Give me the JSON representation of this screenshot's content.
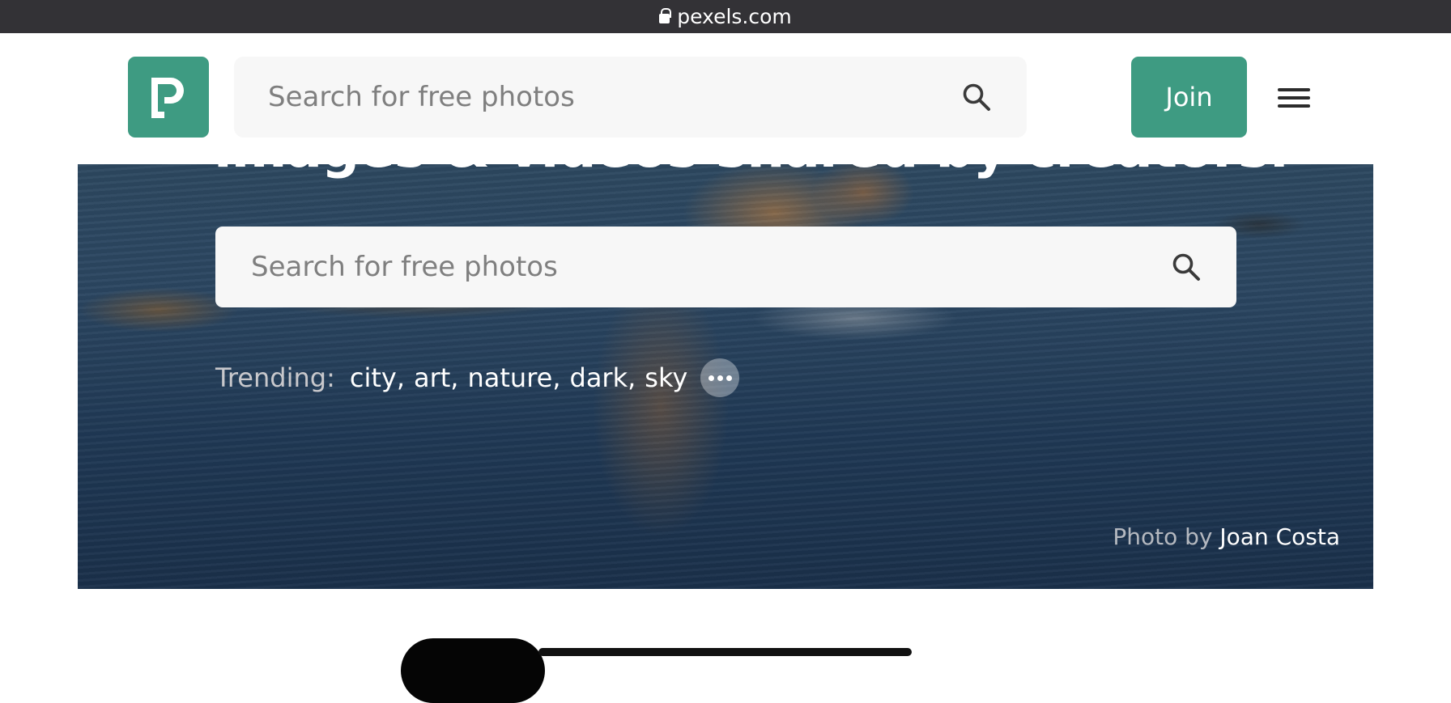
{
  "browser": {
    "url": "pexels.com"
  },
  "header": {
    "search": {
      "placeholder": "Search for free photos"
    },
    "join_label": "Join"
  },
  "hero": {
    "title": "images & videos shared by creators.",
    "search": {
      "placeholder": "Search for free photos"
    },
    "trending": {
      "label": "Trending:",
      "items": [
        "city",
        "art",
        "nature",
        "dark",
        "sky"
      ]
    },
    "credit": {
      "prefix": "Photo by",
      "author": "Joan Costa"
    }
  },
  "colors": {
    "brand": "#3e9b82",
    "url_bar": "#333236",
    "search_bg": "#f7f7f7"
  },
  "icons": {
    "lock": "lock-icon",
    "search": "search-icon",
    "menu": "hamburger-menu-icon",
    "more": "more-horizontal-icon"
  }
}
